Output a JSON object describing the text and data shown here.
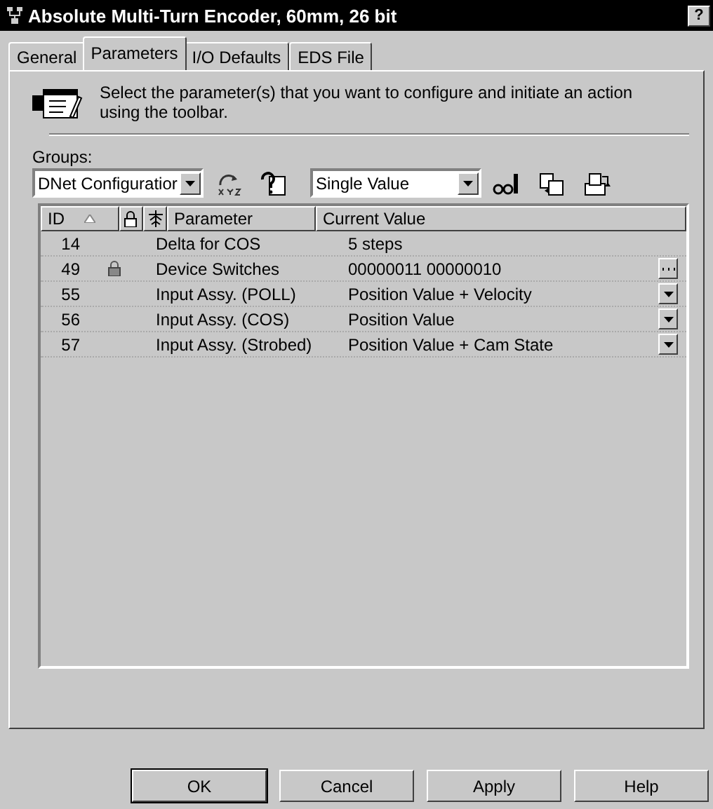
{
  "window": {
    "title": "Absolute Multi-Turn Encoder, 60mm, 26 bit",
    "help_button": "?"
  },
  "tabs": [
    {
      "label": "General",
      "selected": false
    },
    {
      "label": "Parameters",
      "selected": true
    },
    {
      "label": "I/O Defaults",
      "selected": false
    },
    {
      "label": "EDS File",
      "selected": false
    }
  ],
  "instructions": "Select the parameter(s) that you want to configure and initiate an action using the toolbar.",
  "groups": {
    "label": "Groups:",
    "value": "DNet Configuratior"
  },
  "view_mode": {
    "value": "Single Value"
  },
  "table": {
    "columns": [
      "ID",
      "Parameter",
      "Current Value"
    ],
    "rows": [
      {
        "id": "14",
        "locked": false,
        "parameter": "Delta for COS",
        "value": "5 steps",
        "kind": "plain"
      },
      {
        "id": "49",
        "locked": true,
        "parameter": "Device Switches",
        "value": "00000011 00000010",
        "kind": "ellipsis"
      },
      {
        "id": "55",
        "locked": false,
        "parameter": "Input Assy. (POLL)",
        "value": "Position Value + Velocity",
        "kind": "dropdown"
      },
      {
        "id": "56",
        "locked": false,
        "parameter": "Input Assy. (COS)",
        "value": "Position Value",
        "kind": "dropdown"
      },
      {
        "id": "57",
        "locked": false,
        "parameter": "Input Assy. (Strobed)",
        "value": "Position Value + Cam State",
        "kind": "dropdown"
      }
    ]
  },
  "buttons": [
    {
      "label": "OK",
      "default": true
    },
    {
      "label": "Cancel",
      "default": false
    },
    {
      "label": "Apply",
      "default": false
    },
    {
      "label": "Help",
      "default": false
    }
  ]
}
